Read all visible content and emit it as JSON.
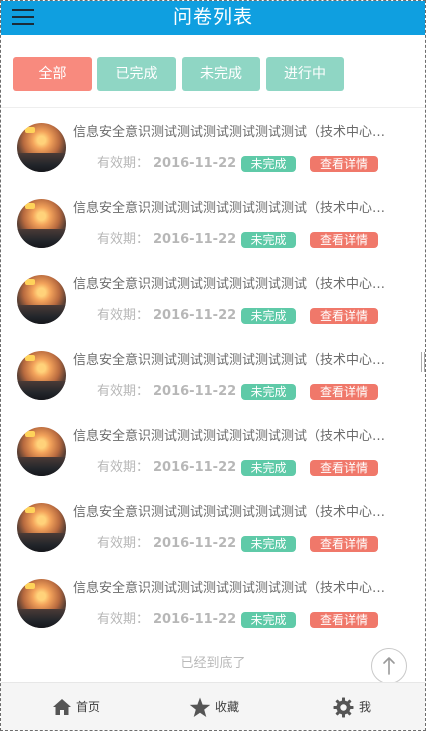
{
  "header": {
    "title": "问卷列表"
  },
  "filters": [
    {
      "label": "全部",
      "active": true
    },
    {
      "label": "已完成",
      "active": false
    },
    {
      "label": "未完成",
      "active": false
    },
    {
      "label": "进行中",
      "active": false
    }
  ],
  "list": {
    "items": [
      {
        "title": "信息安全意识测试测试测试测试测试测试（技术中心…",
        "expiry_label": "有效期：",
        "expiry_date": "2016-11-22",
        "status": "未完成",
        "detail_label": "查看详情"
      },
      {
        "title": "信息安全意识测试测试测试测试测试测试（技术中心…",
        "expiry_label": "有效期：",
        "expiry_date": "2016-11-22",
        "status": "未完成",
        "detail_label": "查看详情"
      },
      {
        "title": "信息安全意识测试测试测试测试测试测试（技术中心…",
        "expiry_label": "有效期：",
        "expiry_date": "2016-11-22",
        "status": "未完成",
        "detail_label": "查看详情"
      },
      {
        "title": "信息安全意识测试测试测试测试测试测试（技术中心…",
        "expiry_label": "有效期：",
        "expiry_date": "2016-11-22",
        "status": "未完成",
        "detail_label": "查看详情"
      },
      {
        "title": "信息安全意识测试测试测试测试测试测试（技术中心…",
        "expiry_label": "有效期：",
        "expiry_date": "2016-11-22",
        "status": "未完成",
        "detail_label": "查看详情"
      },
      {
        "title": "信息安全意识测试测试测试测试测试测试（技术中心…",
        "expiry_label": "有效期：",
        "expiry_date": "2016-11-22",
        "status": "未完成",
        "detail_label": "查看详情"
      },
      {
        "title": "信息安全意识测试测试测试测试测试测试（技术中心…",
        "expiry_label": "有效期：",
        "expiry_date": "2016-11-22",
        "status": "未完成",
        "detail_label": "查看详情"
      }
    ],
    "end_text": "已经到底了"
  },
  "tabbar": [
    {
      "label": "首页",
      "icon": "home-icon"
    },
    {
      "label": "收藏",
      "icon": "star-icon"
    },
    {
      "label": "我",
      "icon": "gear-icon"
    }
  ],
  "icons": {
    "menu": "menu-icon",
    "back_to_top": "arrow-up-icon",
    "avatar": "survey-thumbnail"
  },
  "colors": {
    "header_bg": "#0f9fe0",
    "filter_active": "#f88a7e",
    "filter_inactive": "#8fd6c4",
    "status_tag": "#5fcaa8",
    "detail_button": "#f0786a",
    "muted_text": "#b7b7b7"
  }
}
